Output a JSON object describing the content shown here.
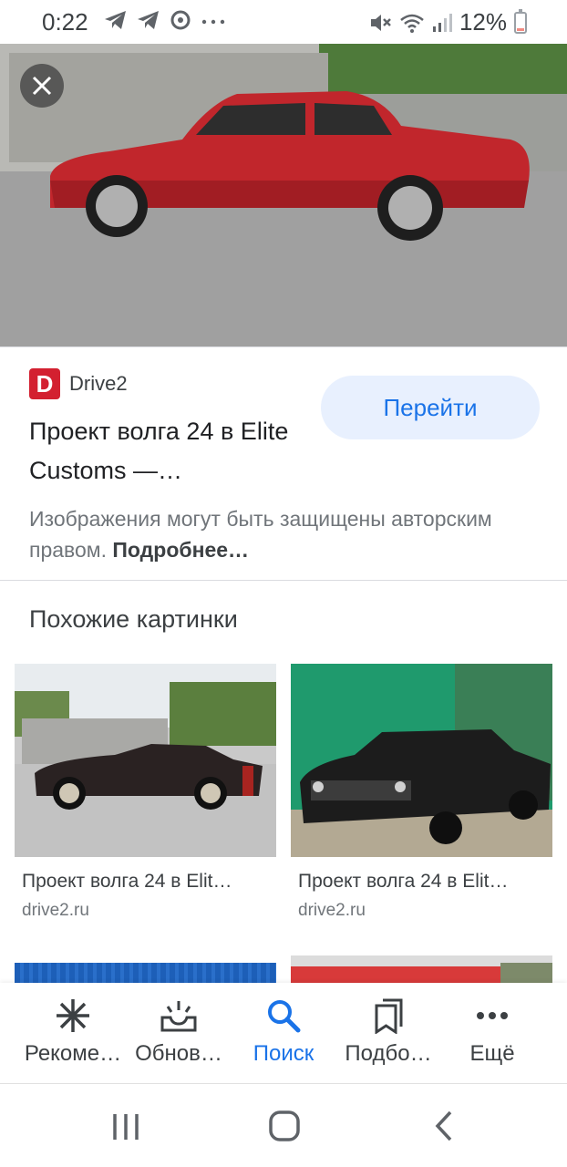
{
  "status_bar": {
    "time": "0:22",
    "battery": "12%",
    "battery_level": 0.12
  },
  "hero": {
    "close_icon": "close-icon"
  },
  "source": {
    "logo_letter": "D",
    "name": "Drive2",
    "brand_color": "#d32030"
  },
  "actions": {
    "goto_label": "Перейти"
  },
  "result": {
    "title": "Проект волга 24 в Elite Customs —…",
    "copyright_text": "Изображения могут быть защищены авторским правом. ",
    "copyright_more": "Подробнее…"
  },
  "similar": {
    "heading": "Похожие картинки",
    "items": [
      {
        "title": "Проект волга 24 в Elit…",
        "source": "drive2.ru"
      },
      {
        "title": "Проект волга 24 в Elit…",
        "source": "drive2.ru"
      }
    ]
  },
  "bottom_nav": {
    "items": [
      {
        "label": "Рекоме…",
        "icon": "asterisk-icon"
      },
      {
        "label": "Обнов…",
        "icon": "updates-tray-icon"
      },
      {
        "label": "Поиск",
        "icon": "search-icon",
        "active": true
      },
      {
        "label": "Подбо…",
        "icon": "collections-icon"
      },
      {
        "label": "Ещё",
        "icon": "more-dots-icon"
      }
    ]
  },
  "colors": {
    "accent": "#1a73e8",
    "accent_bg": "#e8f0fe"
  }
}
